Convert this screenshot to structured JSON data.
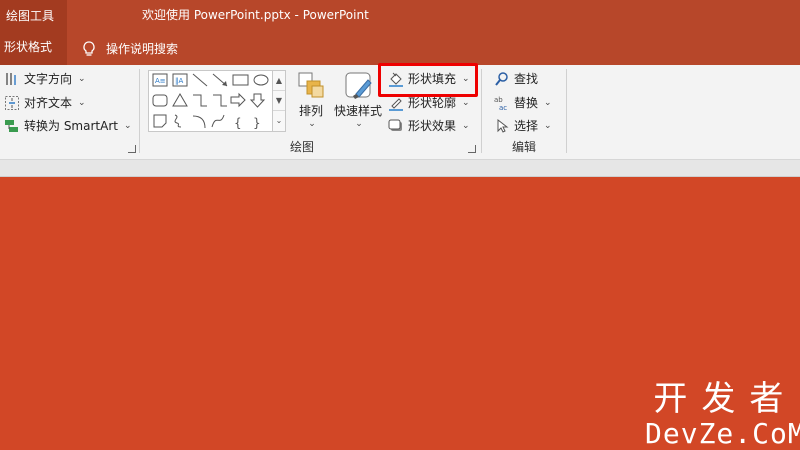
{
  "titlebar": {
    "context_tool": "绘图工具",
    "doc_title": "欢迎使用 PowerPoint.pptx  -  PowerPoint"
  },
  "tabs": {
    "active": "形状格式",
    "tell_me": "操作说明搜索"
  },
  "ribbon": {
    "text_group": {
      "direction": "文字方向",
      "align": "对齐文本",
      "smartart": "转换为 SmartArt"
    },
    "drawing_group": {
      "label": "绘图",
      "arrange": "排列",
      "quick_styles": "快速样式",
      "shape_fill": "形状填充",
      "shape_outline": "形状轮廓",
      "shape_effects": "形状效果"
    },
    "editing_group": {
      "label": "编辑",
      "find": "查找",
      "replace": "替换",
      "select": "选择"
    }
  },
  "watermark": {
    "line1": "开发者",
    "line2": "DevZe.CoM"
  },
  "colors": {
    "titlebar": "#b7472a",
    "slide_bg": "#d24726",
    "highlight": "#ee0000"
  }
}
